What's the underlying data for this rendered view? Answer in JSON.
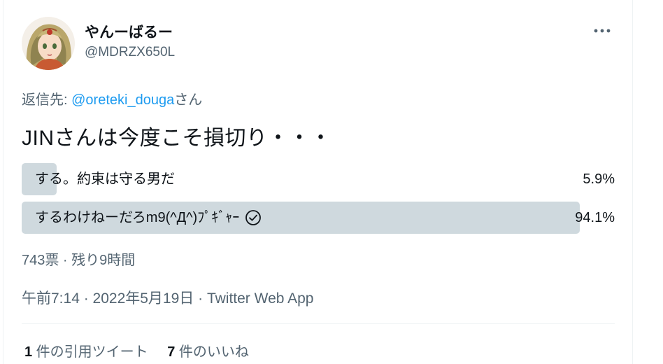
{
  "tweet": {
    "author": {
      "display_name": "やんーばるー",
      "handle": "@MDRZX650L"
    },
    "reply_to": {
      "prefix": "返信先: ",
      "mention": "@oreteki_douga",
      "suffix": "さん"
    },
    "text": "JINさんは今度こそ損切り・・・",
    "poll": {
      "options": [
        {
          "label": "する。約束は守る男だ",
          "percent_text": "5.9%",
          "percent": 5.9,
          "winner": false
        },
        {
          "label": "するわけねーだろm9(^Д^)ﾌﾟｷﾞｬｰ",
          "percent_text": "94.1%",
          "percent": 94.1,
          "winner": true
        }
      ],
      "meta": "743票 · 残り9時間"
    },
    "timestamp": "午前7:14 · 2022年5月19日 · Twitter Web App",
    "stats": {
      "quote_count": "1",
      "quote_label": " 件の引用ツイート",
      "like_count": "7",
      "like_label": " 件のいいね"
    },
    "colors": {
      "accent": "#1d9bf0",
      "poll_bar": "#cfd9de",
      "secondary_text": "#536471"
    },
    "icons": {
      "more": "more-horizontal-icon",
      "winner": "check-circle-icon"
    }
  }
}
